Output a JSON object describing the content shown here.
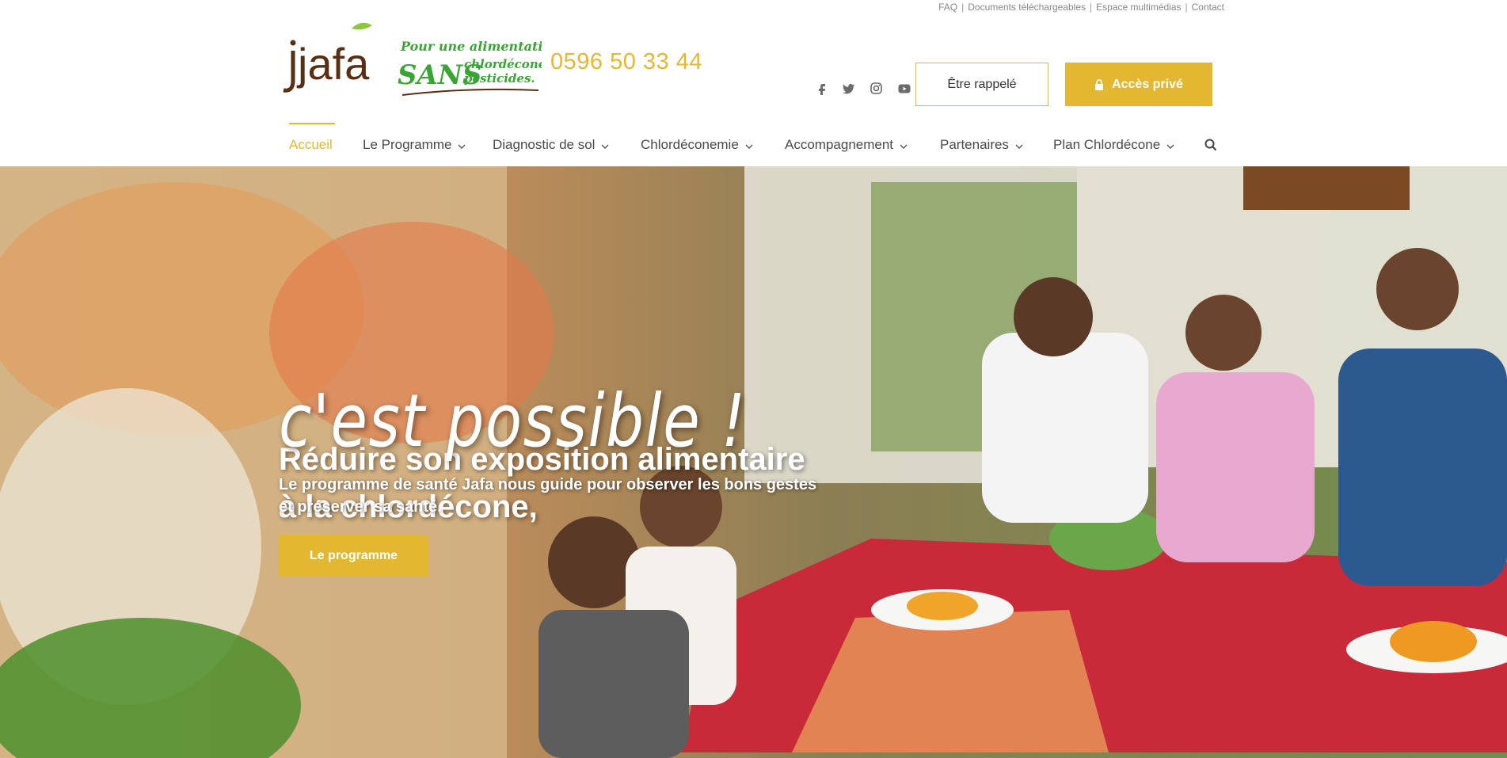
{
  "top_links": [
    "FAQ",
    "Documents téléchargeables",
    "Espace multimédias",
    "Contact"
  ],
  "logo": {
    "text": "jafa"
  },
  "tagline": {
    "line1": "Pour une alimentation",
    "sans": "SANS",
    "line2": "chlordécone",
    "line3": "pesticides."
  },
  "phone": "0596 50 33 44",
  "social_icons": [
    "facebook-icon",
    "twitter-icon",
    "instagram-icon",
    "youtube-icon"
  ],
  "buttons": {
    "call": "Être rappelé",
    "private": "Accès privé"
  },
  "nav": [
    {
      "label": "Accueil",
      "active": true
    },
    {
      "label": "Le Programme",
      "dropdown": true
    },
    {
      "label": "Diagnostic de sol",
      "dropdown": true
    },
    {
      "label": "Chlordéconemie",
      "dropdown": true
    },
    {
      "label": "Accompagnement",
      "dropdown": true
    },
    {
      "label": "Partenaires",
      "dropdown": true
    },
    {
      "label": "Plan Chlordécone",
      "dropdown": true
    }
  ],
  "hero": {
    "title_line1": "Réduire son exposition alimentaire",
    "title_line2": "à la chlordécone,",
    "script": "c'est possible !",
    "description": "Le programme de santé Jafa nous guide pour observer les bons gestes et préserver sa santé.",
    "cta": "Le programme"
  },
  "colors": {
    "accent": "#e3b830",
    "green": "#3aa535",
    "brown": "#5a2e12"
  }
}
